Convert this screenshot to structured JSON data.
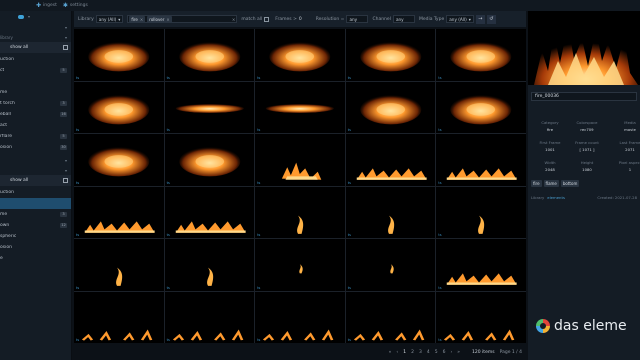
{
  "topbar": {
    "items": [
      {
        "icon": "plus-icon",
        "label": "ingest"
      },
      {
        "icon": "gear-icon",
        "label": "settings"
      }
    ]
  },
  "sidebar": {
    "section1": {
      "header": "",
      "subheader": "library",
      "show_all": "show all",
      "items": [
        {
          "label": "uction",
          "count": ""
        },
        {
          "label": "ct",
          "count": "5"
        },
        {
          "label": "",
          "count": ""
        },
        {
          "label": "me",
          "count": ""
        },
        {
          "label": "t torch",
          "count": "3"
        },
        {
          "label": "eball",
          "count": "16"
        },
        {
          "label": "act",
          "count": ""
        },
        {
          "label": "rflare",
          "count": "5"
        },
        {
          "label": "osion",
          "count": "30"
        }
      ]
    },
    "section2": {
      "show_all": "show all",
      "items": [
        {
          "label": "uction",
          "count": ""
        },
        {
          "label": "",
          "count": ""
        },
        {
          "label": "me",
          "count": "3"
        },
        {
          "label": "own",
          "count": "12"
        },
        {
          "label": "spheric",
          "count": ""
        },
        {
          "label": "osion",
          "count": ""
        },
        {
          "label": "e",
          "count": ""
        }
      ]
    }
  },
  "filterbar": {
    "library_label": "Library",
    "library_value": "any (All)",
    "chips": [
      "fire",
      "rollover"
    ],
    "match_all_label": "match all",
    "frames_label": "Frames >",
    "frames_value": "0",
    "resolution_label": "Resolution =",
    "resolution_value": "any",
    "channel_label": "Channel",
    "channel_value": "any",
    "media_type_label": "Media Type",
    "media_type_value": "any (All)"
  },
  "grid": {
    "tag": "ts",
    "rows": 6,
    "cols": 5
  },
  "pager": {
    "pages": [
      "1",
      "2",
      "3",
      "4",
      "5",
      "6"
    ],
    "items": "120 items",
    "page_label": "Page 1 / 4"
  },
  "detail": {
    "asset_name": "fire_00036",
    "meta": [
      {
        "k": "Category",
        "v": "fire"
      },
      {
        "k": "Colorspace",
        "v": "rec709"
      },
      {
        "k": "Media",
        "v": "movie"
      },
      {
        "k": "First Frame",
        "v": "1001"
      },
      {
        "k": "Frame count",
        "v": "[ 1071 ]"
      },
      {
        "k": "Last Frame",
        "v": "2071"
      },
      {
        "k": "Width",
        "v": "2048"
      },
      {
        "k": "Height",
        "v": "1080"
      },
      {
        "k": "Pixel aspect",
        "v": "1"
      }
    ],
    "tags": [
      "fire",
      "flame",
      "bottom"
    ],
    "library_key": "Library",
    "library_value": "elements",
    "created": "Created: 2021-07-28"
  },
  "logo": {
    "text": "das eleme"
  },
  "colors": {
    "accent": "#3ea2d8",
    "fire": "#ff9a2e",
    "bg": "#0c1117"
  }
}
